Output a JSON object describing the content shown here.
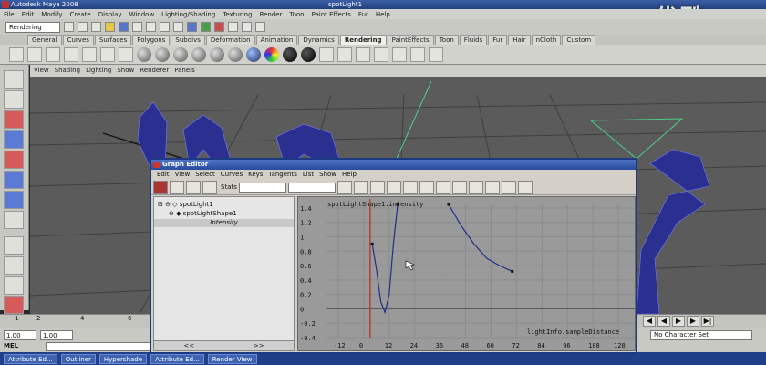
{
  "window": {
    "title": "Autodesk Maya 2008 ",
    "scene_name": "spotLight1"
  },
  "watermark": "优酷",
  "main_menu": [
    "File",
    "Edit",
    "Modify",
    "Create",
    "Display",
    "Window",
    "Lighting/Shading",
    "Texturing",
    "Render",
    "Toon",
    "Paint Effects",
    "Fur",
    "Help"
  ],
  "status_line": {
    "mode": "Rendering"
  },
  "shelf_tabs": [
    "General",
    "Curves",
    "Surfaces",
    "Polygons",
    "Subdivs",
    "Deformation",
    "Animation",
    "Dynamics",
    "Rendering",
    "PaintEffects",
    "Toon",
    "Fluids",
    "Fur",
    "Hair",
    "nCloth",
    "Custom"
  ],
  "active_shelf_tab": "Rendering",
  "viewport_menu": [
    "View",
    "Shading",
    "Lighting",
    "Show",
    "Renderer",
    "Panels"
  ],
  "time_slider": {
    "frames": [
      "1",
      "2",
      "4",
      "6"
    ]
  },
  "range": {
    "start": "1.00",
    "current": "1.00"
  },
  "command_line": {
    "label": "MEL"
  },
  "character_set": "No Character Set",
  "taskbar": [
    "Attribute Ed...",
    "Outliner",
    "Hypershade",
    "Attribute Ed...",
    "Render View"
  ],
  "graph_editor": {
    "title": "Graph Editor",
    "menu": [
      "Edit",
      "View",
      "Select",
      "Curves",
      "Keys",
      "Tangents",
      "List",
      "Show",
      "Help"
    ],
    "stats_label": "Stats",
    "outliner_items": [
      {
        "label": "spotLight1"
      },
      {
        "label": "spotLightShape1"
      },
      {
        "label": "Intensity"
      }
    ],
    "outliner_buttons": [
      "<<",
      ">>"
    ],
    "curve_label": "spotLightShape1.intensity",
    "input_label": "lightInfo.sampleDistance",
    "y_ticks": [
      "1.4",
      "1.2",
      "1",
      "0.8",
      "0.6",
      "0.4",
      "0.2",
      "0",
      "-0.2",
      "-0.4"
    ],
    "x_ticks": [
      "-12",
      "0",
      "12",
      "24",
      "36",
      "48",
      "60",
      "72",
      "84",
      "96",
      "108",
      "120"
    ]
  },
  "chart_data": {
    "type": "line",
    "title": "spotLightShape1.intensity",
    "xlabel": "lightInfo.sampleDistance",
    "ylabel": "",
    "xlim": [
      -18,
      126
    ],
    "ylim": [
      -0.4,
      1.45
    ],
    "series": [
      {
        "name": "spotLightShape1.intensity",
        "color": "#1f2f8a",
        "x": [
          4,
          6,
          8,
          10,
          12,
          14,
          16
        ],
        "y": [
          0.9,
          0.55,
          0.1,
          -0.05,
          0.2,
          0.9,
          1.45
        ]
      },
      {
        "name": "spotLightShape1.intensity",
        "color": "#1f2f8a",
        "x": [
          40,
          46,
          52,
          58,
          64,
          70
        ],
        "y": [
          1.45,
          1.15,
          0.9,
          0.7,
          0.6,
          0.52
        ]
      }
    ],
    "time_marker_x": 3,
    "grid": true
  }
}
